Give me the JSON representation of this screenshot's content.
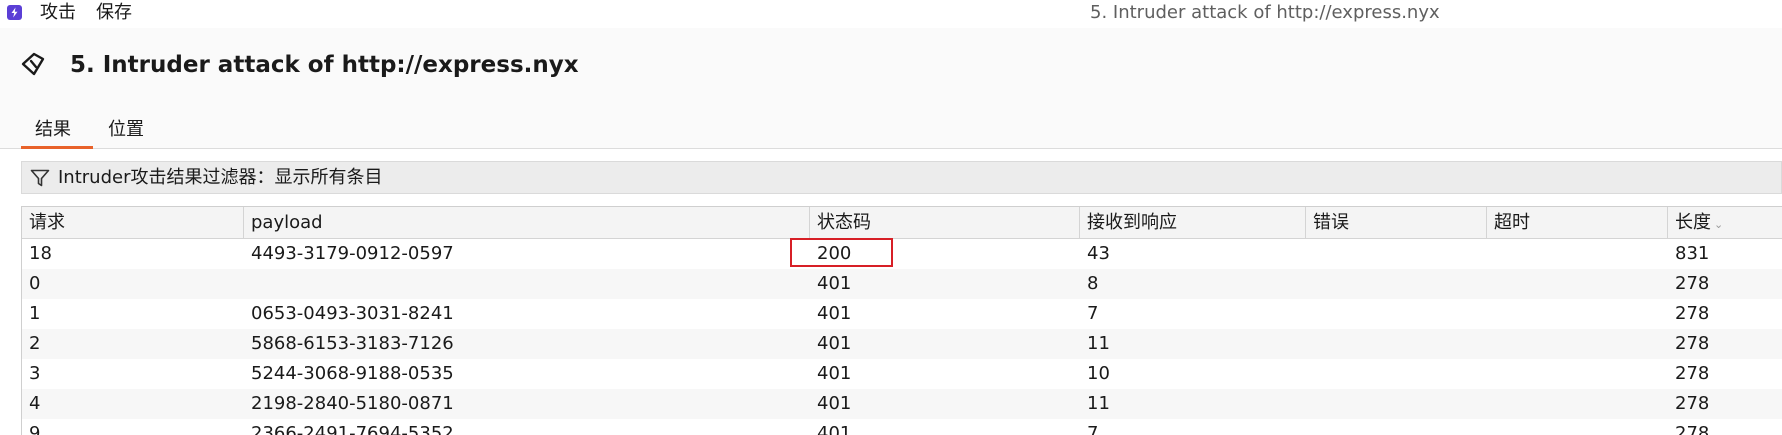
{
  "menubar": {
    "logo_icon": "burp-logo-icon",
    "attack_label": "攻击",
    "save_label": "保存",
    "window_title": "5. Intruder attack of http://express.nyx"
  },
  "header": {
    "icon": "intruder-icon",
    "title": "5. Intruder attack of http://express.nyx"
  },
  "tabs": [
    {
      "label": "结果",
      "active": true
    },
    {
      "label": "位置",
      "active": false
    }
  ],
  "accent_color": "#e8622a",
  "highlight_color": "#d71f26",
  "filter": {
    "icon": "filter-icon",
    "text": "Intruder攻击结果过滤器：显示所有条目"
  },
  "table": {
    "columns": [
      "请求",
      "payload",
      "状态码",
      "接收到响应",
      "错误",
      "超时",
      "长度"
    ],
    "sorted_column": "长度",
    "rows": [
      {
        "request": "18",
        "payload": "4493-3179-0912-0597",
        "status": "200",
        "received": "43",
        "error": "",
        "timeout": "",
        "length": "831"
      },
      {
        "request": "0",
        "payload": "",
        "status": "401",
        "received": "8",
        "error": "",
        "timeout": "",
        "length": "278"
      },
      {
        "request": "1",
        "payload": "0653-0493-3031-8241",
        "status": "401",
        "received": "7",
        "error": "",
        "timeout": "",
        "length": "278"
      },
      {
        "request": "2",
        "payload": "5868-6153-3183-7126",
        "status": "401",
        "received": "11",
        "error": "",
        "timeout": "",
        "length": "278"
      },
      {
        "request": "3",
        "payload": "5244-3068-9188-0535",
        "status": "401",
        "received": "10",
        "error": "",
        "timeout": "",
        "length": "278"
      },
      {
        "request": "4",
        "payload": "2198-2840-5180-0871",
        "status": "401",
        "received": "11",
        "error": "",
        "timeout": "",
        "length": "278"
      },
      {
        "request": "9",
        "payload": "2366-2491-7694-5352",
        "status": "401",
        "received": "7",
        "error": "",
        "timeout": "",
        "length": "278"
      }
    ]
  }
}
